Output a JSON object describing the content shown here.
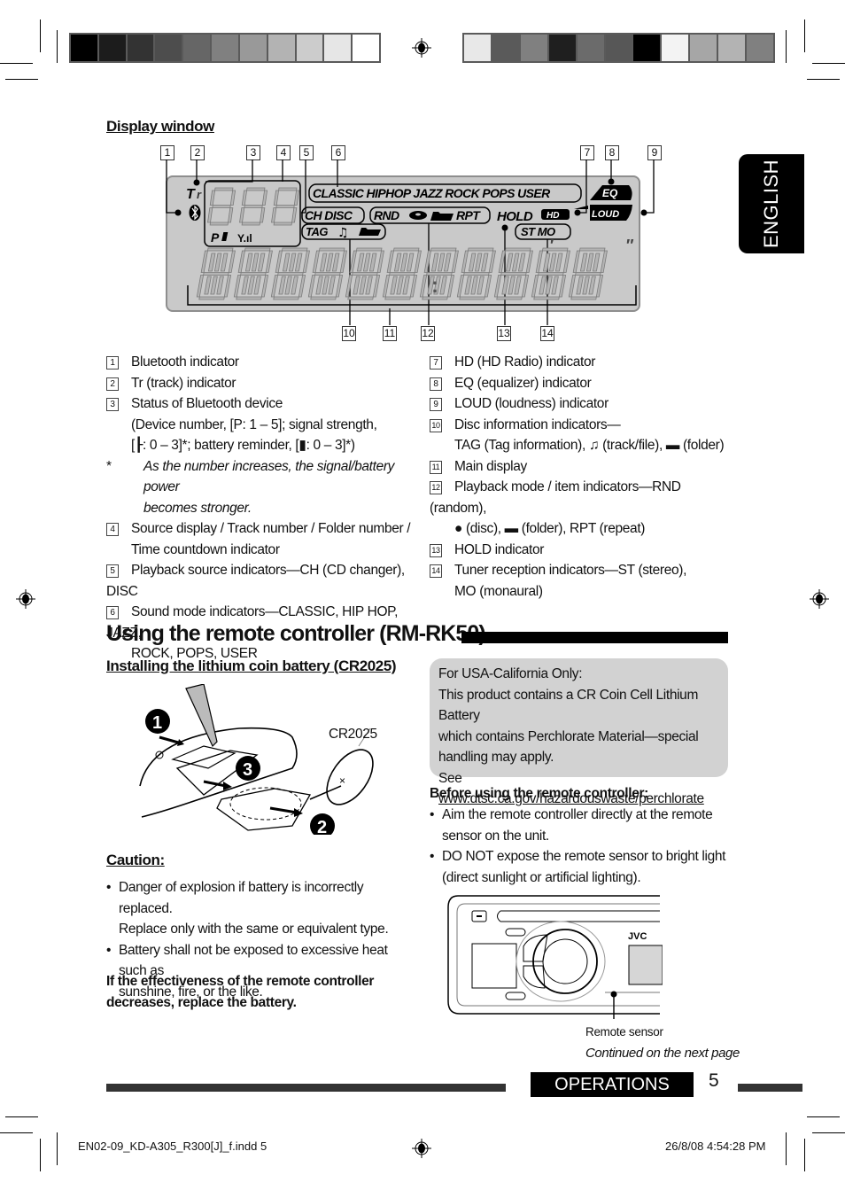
{
  "print_marks": {
    "color_bar_left": [
      "#000000",
      "#1c1c1c",
      "#333333",
      "#4d4d4d",
      "#666666",
      "#808080",
      "#999999",
      "#b3b3b3",
      "#cccccc",
      "#e6e6e6",
      "#ffffff"
    ],
    "color_bar_right": [
      "#e8e8e8",
      "#5a5a5a",
      "#808080",
      "#1f1f1f",
      "#6b6b6b",
      "#575757",
      "#000000",
      "#f3f3f3",
      "#a6a6a6",
      "#b3b3b3",
      "#808080"
    ]
  },
  "language_tab": "ENGLISH",
  "display_window": {
    "heading": "Display window",
    "callouts": [
      "1",
      "2",
      "3",
      "4",
      "5",
      "6",
      "7",
      "8",
      "9",
      "10",
      "11",
      "12",
      "13",
      "14"
    ],
    "lcd": {
      "sound_modes": "CLASSIC HIPHOP JAZZ ROCK POPS USER",
      "eq": "EQ",
      "loud": "LOUD",
      "ch_disc": "CH DISC",
      "rnd": "RND",
      "rpt": "RPT",
      "hold": "HOLD",
      "hd": "HD",
      "tag": "TAG",
      "st_mo": "ST MO",
      "tr": "Tr",
      "p": "P"
    }
  },
  "legend_left": [
    {
      "num": "1",
      "lines": [
        "Bluetooth indicator"
      ]
    },
    {
      "num": "2",
      "lines": [
        "Tr (track) indicator"
      ]
    },
    {
      "num": "3",
      "lines": [
        "Status of Bluetooth device",
        "(Device number, [P: 1 – 5]; signal strength,",
        "[┠: 0 – 3]*; battery reminder, [▮: 0 – 3]*)"
      ]
    },
    {
      "num": "*",
      "note": [
        "As the number increases, the signal/battery power",
        "becomes stronger."
      ]
    },
    {
      "num": "4",
      "lines": [
        "Source display / Track number / Folder number /",
        "Time countdown indicator"
      ]
    },
    {
      "num": "5",
      "lines": [
        "Playback source indicators—CH (CD changer), DISC"
      ]
    },
    {
      "num": "6",
      "lines": [
        "Sound mode indicators—CLASSIC, HIP HOP, JAZZ,",
        "ROCK, POPS, USER"
      ]
    }
  ],
  "legend_right": [
    {
      "num": "7",
      "lines": [
        "HD (HD Radio) indicator"
      ]
    },
    {
      "num": "8",
      "lines": [
        "EQ (equalizer) indicator"
      ]
    },
    {
      "num": "9",
      "lines": [
        "LOUD (loudness) indicator"
      ]
    },
    {
      "num": "10",
      "lines": [
        "Disc information indicators—",
        "TAG (Tag information), ♫ (track/file), ▬ (folder)"
      ]
    },
    {
      "num": "11",
      "lines": [
        "Main display"
      ]
    },
    {
      "num": "12",
      "lines": [
        "Playback mode / item indicators—RND (random),",
        "● (disc), ▬ (folder), RPT (repeat)"
      ]
    },
    {
      "num": "13",
      "lines": [
        "HOLD indicator"
      ]
    },
    {
      "num": "14",
      "lines": [
        "Tuner reception indicators—ST (stereo),",
        "MO (monaural)"
      ]
    }
  ],
  "remote_section": {
    "title": "Using the remote controller (RM-RK50)",
    "battery_heading": "Installing the lithium coin battery (CR2025)",
    "battery_label": "CR2025",
    "step_numbers": [
      "1",
      "2",
      "3"
    ],
    "caution_heading": "Caution:",
    "caution_items": [
      [
        "Danger of explosion if battery is incorrectly replaced.",
        "Replace only with the same or equivalent type."
      ],
      [
        "Battery shall not be exposed to excessive heat such as",
        "sunshine, fire, or the like."
      ]
    ],
    "replace_note": [
      "If the effectiveness of the remote controller",
      "decreases, replace the battery."
    ],
    "california_note": {
      "lines": [
        "For USA-California Only:",
        "This product contains a CR Coin Cell Lithium Battery",
        "which contains Perchlorate Material—special",
        "handling may apply."
      ],
      "see": "See ",
      "link": "www.dtsc.ca.gov/hazardouswaste/perchlorate"
    },
    "before_heading": "Before using the remote controller:",
    "before_items": [
      [
        "Aim the remote controller directly at the remote",
        "sensor on the unit."
      ],
      [
        "DO NOT expose the remote sensor to bright light",
        "(direct sunlight or artificial lighting)."
      ]
    ],
    "unit_brand": "JVC",
    "sensor_label": "Remote sensor",
    "continued": "Continued on the next page"
  },
  "footer": {
    "section": "OPERATIONS",
    "page": "5",
    "file_slug": "EN02-09_KD-A305_R300[J]_f.indd   5",
    "timestamp": "26/8/08   4:54:28 PM"
  }
}
